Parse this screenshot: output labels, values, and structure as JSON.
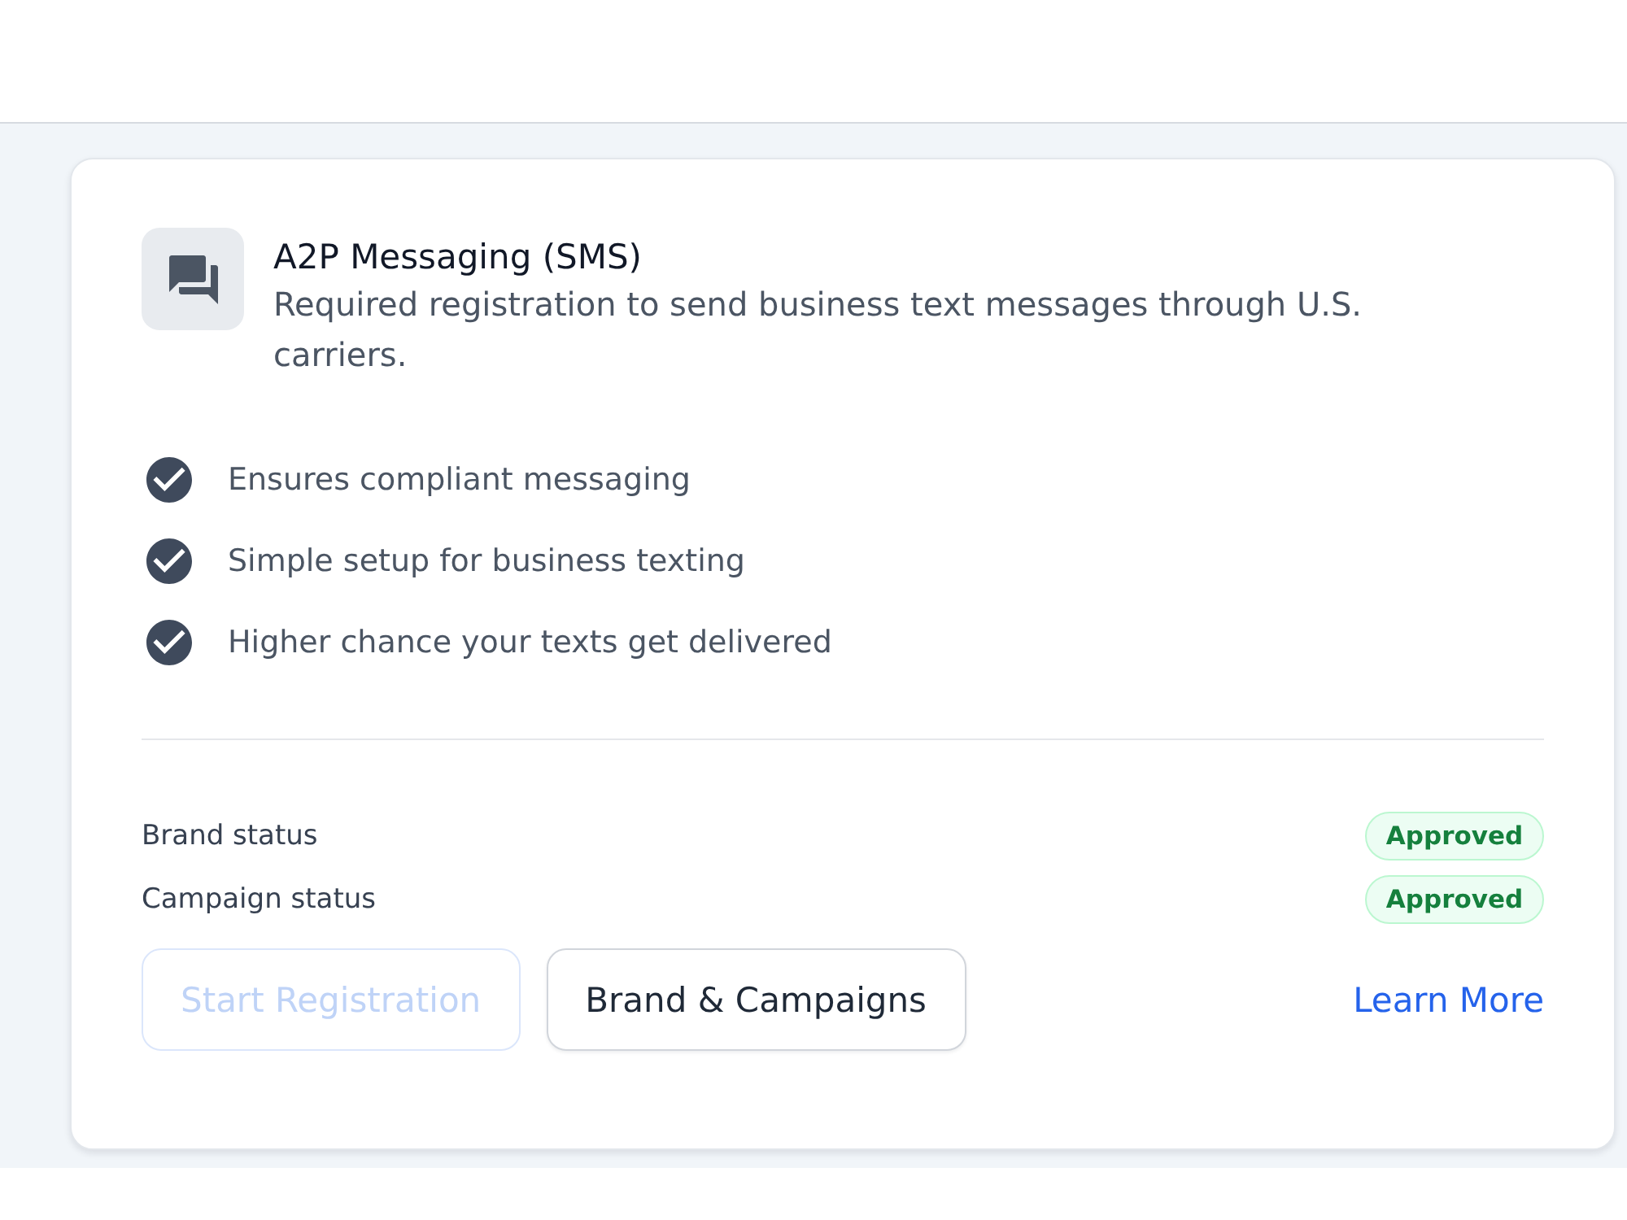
{
  "card": {
    "title": "A2P Messaging (SMS)",
    "description": "Required registration to send business text messages through U.S. carriers.",
    "features": [
      "Ensures compliant messaging",
      "Simple setup for business texting",
      "Higher chance your texts get delivered"
    ],
    "statuses": [
      {
        "label": "Brand status",
        "badge": "Approved"
      },
      {
        "label": "Campaign status",
        "badge": "Approved"
      }
    ],
    "buttons": [
      {
        "label": "Start Registration",
        "disabled": true
      },
      {
        "label": "Brand & Campaigns",
        "disabled": false
      }
    ],
    "link": "Learn More"
  }
}
